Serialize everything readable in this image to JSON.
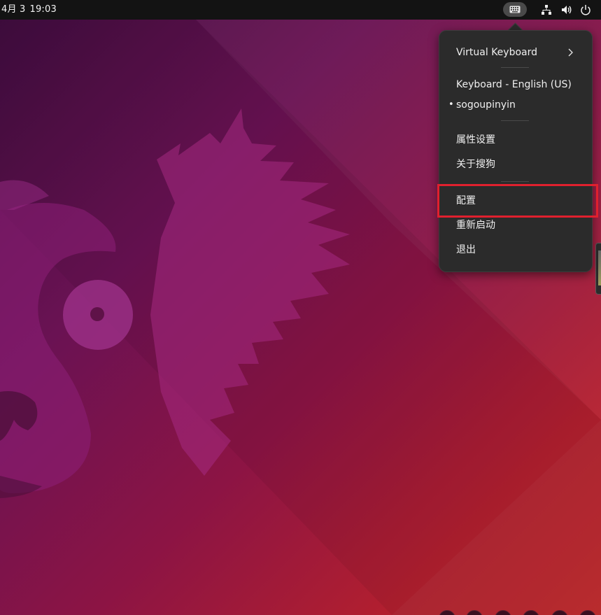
{
  "topbar": {
    "date": "4月 3",
    "time": "19:03",
    "icons": [
      "keyboard-icon",
      "network-icon",
      "volume-icon",
      "power-icon"
    ]
  },
  "menu": {
    "virtual_keyboard": "Virtual Keyboard",
    "keyboard_layout": "Keyboard - English (US)",
    "input_method": "sogoupinyin",
    "input_method_bullet": "•",
    "preferences": "属性设置",
    "about": "关于搜狗",
    "configure": "配置",
    "restart": "重新启动",
    "quit": "退出"
  },
  "colors": {
    "topbar_bg": "#131313",
    "menu_bg": "#2b2b2b",
    "highlight_border": "#e0202e",
    "wallpaper_purple": "#6a1253",
    "wallpaper_red": "#b21f2f"
  }
}
